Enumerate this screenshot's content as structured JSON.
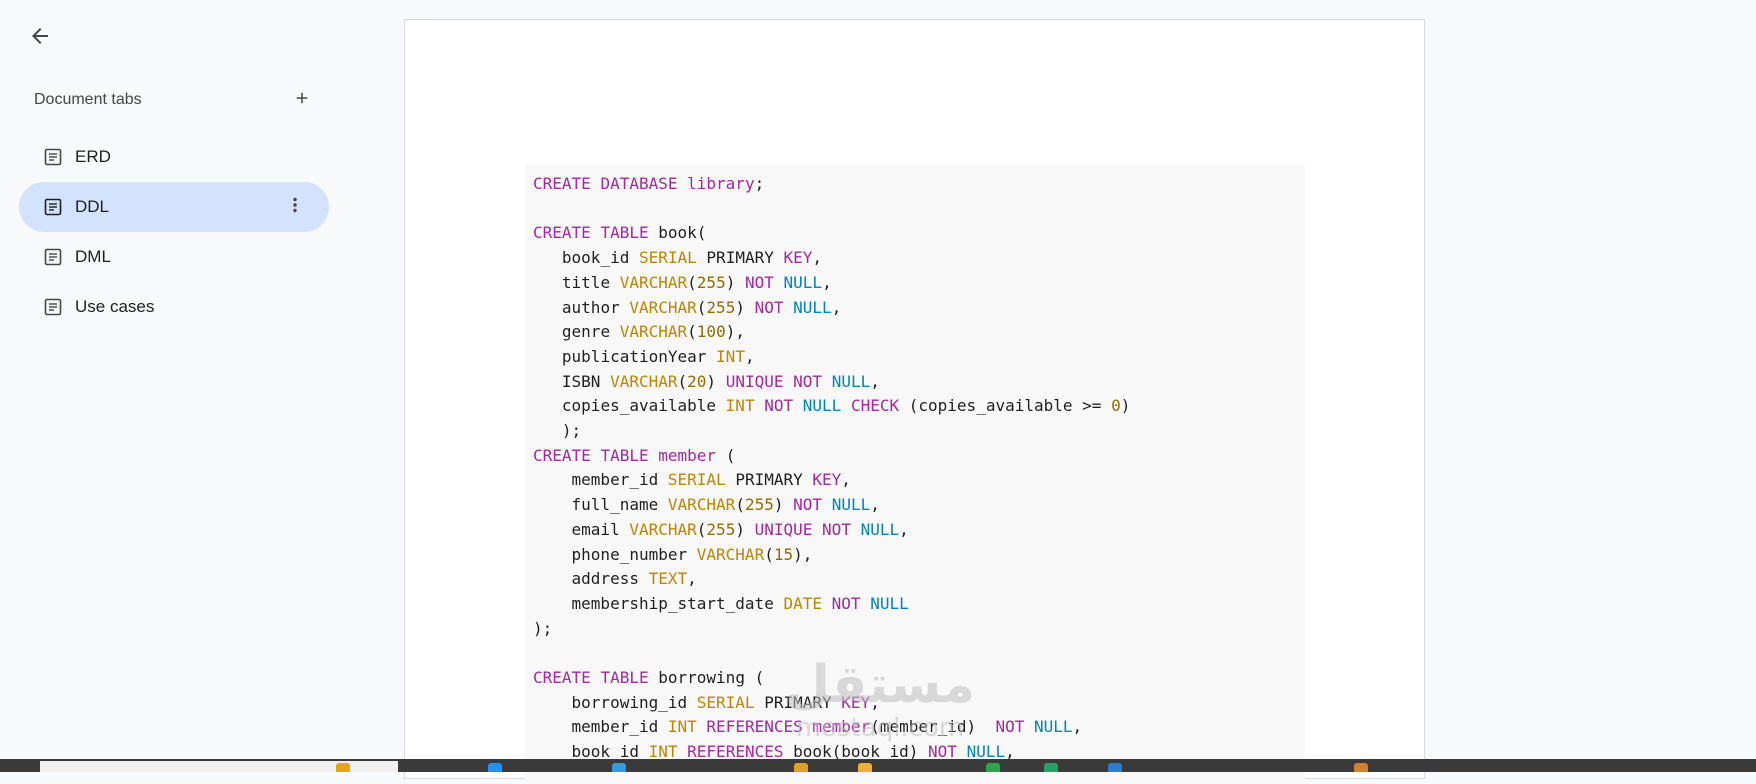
{
  "sidebar": {
    "header": "Document tabs",
    "tabs": [
      {
        "label": "ERD",
        "active": false
      },
      {
        "label": "DDL",
        "active": true
      },
      {
        "label": "DML",
        "active": false
      },
      {
        "label": "Use cases",
        "active": false
      }
    ]
  },
  "icons": {
    "back": "arrow-left-icon",
    "add": "plus-icon",
    "tab": "document-icon",
    "more": "more-vert-icon"
  },
  "colors": {
    "active_tab_bg": "#d3e3fd",
    "code_bg": "#f8f8f8",
    "keyword": "#a626a4",
    "type": "#c18401",
    "number": "#986801",
    "constant": "#0184bc",
    "taskbar": "#3a3a3a"
  },
  "document": {
    "code_lines": [
      "CREATE DATABASE library;",
      "",
      "CREATE TABLE book(",
      "   book_id SERIAL PRIMARY KEY,",
      "   title VARCHAR(255) NOT NULL,",
      "   author VARCHAR(255) NOT NULL,",
      "   genre VARCHAR(100),",
      "   publicationYear INT,",
      "   ISBN VARCHAR(20) UNIQUE NOT NULL,",
      "   copies_available INT NOT NULL CHECK (copies_available >= 0)",
      "   );",
      "CREATE TABLE member (",
      "    member_id SERIAL PRIMARY KEY,",
      "    full_name VARCHAR(255) NOT NULL,",
      "    email VARCHAR(255) UNIQUE NOT NULL,",
      "    phone_number VARCHAR(15),",
      "    address TEXT,",
      "    membership_start_date DATE NOT NULL",
      ");",
      "",
      "CREATE TABLE borrowing (",
      "    borrowing_id SERIAL PRIMARY KEY,",
      "    member_id INT REFERENCES member(member_id)  NOT NULL,",
      "    book_id INT REFERENCES book(book_id) NOT NULL,"
    ]
  },
  "watermark": {
    "arabic": "مستقل",
    "latin": "mostaql.com"
  }
}
